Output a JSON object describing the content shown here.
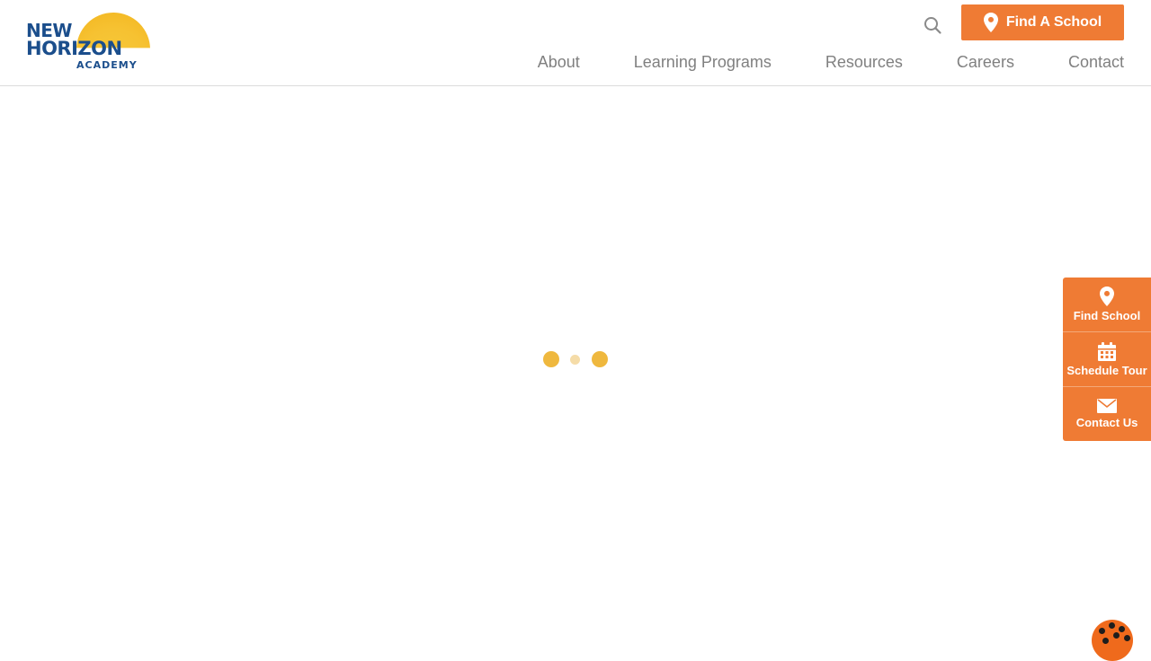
{
  "logo": {
    "line1": "NEW",
    "line2": "HORIZON",
    "line3": "ACADEMY",
    "sun_color": "#f6c232",
    "text_color": "#1b4e8c"
  },
  "header": {
    "search_icon": "search-icon",
    "find_school_label": "Find A School",
    "find_school_icon": "map-pin-icon",
    "accent_color": "#ef7b34"
  },
  "nav": {
    "items": [
      {
        "label": "About"
      },
      {
        "label": "Learning Programs"
      },
      {
        "label": "Resources"
      },
      {
        "label": "Careers"
      },
      {
        "label": "Contact"
      }
    ]
  },
  "loader": {
    "color": "#efb83e"
  },
  "side_widget": {
    "items": [
      {
        "label": "Find School",
        "icon": "map-pin-icon"
      },
      {
        "label": "Schedule Tour",
        "icon": "calendar-icon"
      },
      {
        "label": "Contact Us",
        "icon": "envelope-icon"
      }
    ]
  },
  "cookie": {
    "icon": "cookie-icon"
  }
}
